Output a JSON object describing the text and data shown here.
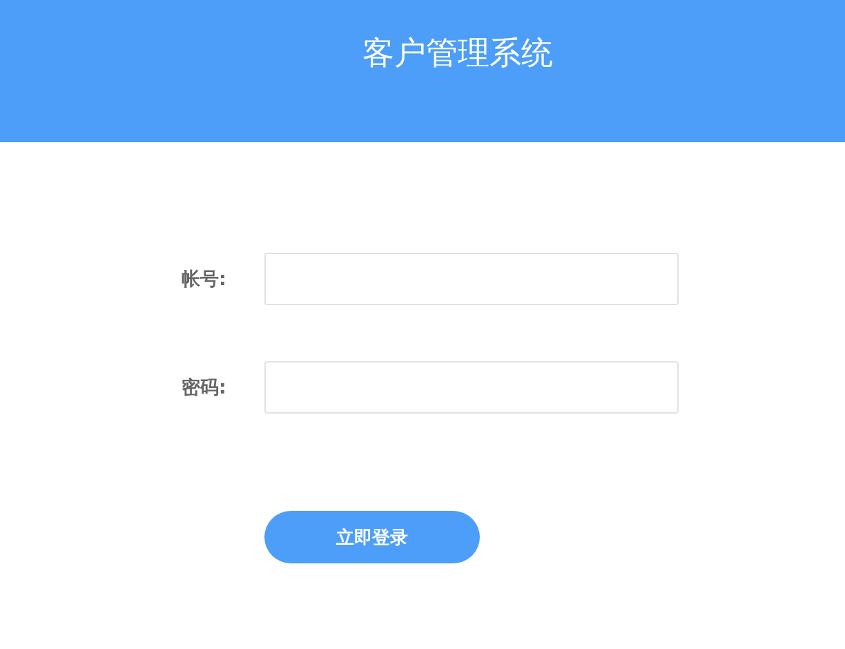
{
  "header": {
    "title": "客户管理系统"
  },
  "fields": [
    {
      "label": "帐号:"
    },
    {
      "label": "密码:"
    }
  ],
  "login_button": {
    "label": "立即登录"
  }
}
